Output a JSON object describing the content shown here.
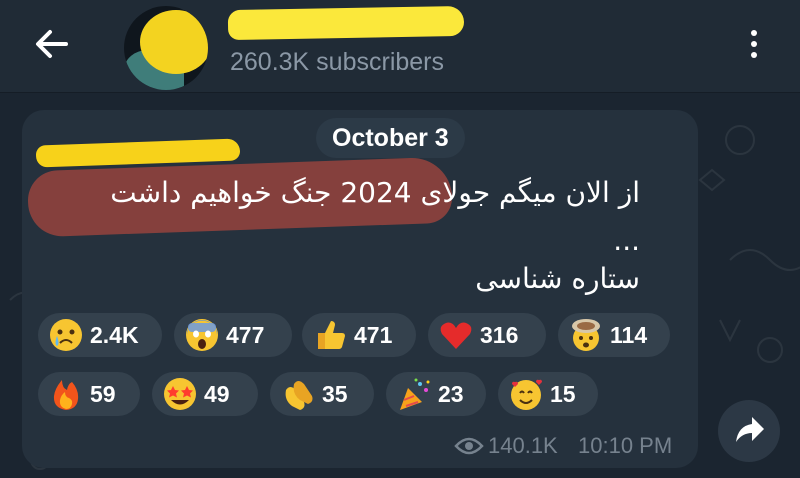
{
  "header": {
    "back_icon": "arrow-left-icon",
    "subscribers": "260.3K subscribers",
    "more_icon": "more-vertical-icon"
  },
  "message": {
    "date": "October 3",
    "line1": "از الان میگم جولای 2024 جنگ خواهیم داشت",
    "line2": "...",
    "line3": "ستاره شناسی",
    "views": "140.1K",
    "time": "10:10 PM",
    "views_icon": "eye-icon",
    "share_icon": "share-arrow-icon"
  },
  "reactions": [
    {
      "emoji": "crying-face",
      "count": "2.4K"
    },
    {
      "emoji": "screaming-face",
      "count": "477"
    },
    {
      "emoji": "thumbs-up",
      "count": "471"
    },
    {
      "emoji": "red-heart",
      "count": "316"
    },
    {
      "emoji": "exploding-head",
      "count": "114"
    },
    {
      "emoji": "fire",
      "count": "59"
    },
    {
      "emoji": "star-struck",
      "count": "49"
    },
    {
      "emoji": "clapping-hands",
      "count": "35"
    },
    {
      "emoji": "party-popper",
      "count": "23"
    },
    {
      "emoji": "smiling-face-with-hearts",
      "count": "15"
    }
  ],
  "colors": {
    "background": "#1b2530",
    "header": "#202b36",
    "bubble": "#25313d",
    "reaction_pill": "#34414d",
    "muted_text": "#8b98a6",
    "redaction_yellow": "#f7d21a",
    "highlight_red": "#a0453e"
  }
}
